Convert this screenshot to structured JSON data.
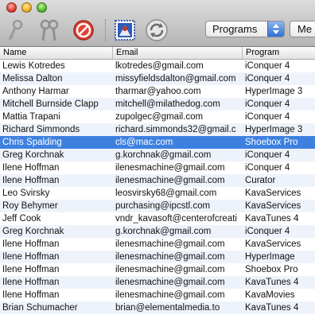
{
  "toolbar": {
    "program_filter": "Programs",
    "menu_button_label": "Me"
  },
  "table": {
    "columns": [
      "Name",
      "Email",
      "Program"
    ],
    "rows": [
      {
        "name": "Lewis Kotredes",
        "email": "lkotredes@gmail.com",
        "program": "iConquer 4"
      },
      {
        "name": "Melissa Dalton",
        "email": "missyfieldsdalton@gmail.com",
        "program": "iConquer 4"
      },
      {
        "name": "Anthony Harmar",
        "email": "tharmar@yahoo.com",
        "program": "HyperImage 3"
      },
      {
        "name": "Mitchell Burnside Clapp",
        "email": "mitchell@milathedog.com",
        "program": "iConquer 4"
      },
      {
        "name": "Mattia Trapani",
        "email": "zupolgec@gmail.com",
        "program": "iConquer 4"
      },
      {
        "name": "Richard Simmonds",
        "email": "richard.simmonds32@gmail.c",
        "program": "HyperImage 3"
      },
      {
        "name": "Chris Spalding",
        "email": "cls@mac.com",
        "program": "Shoebox Pro",
        "selected": true
      },
      {
        "name": "Greg Korchnak",
        "email": "g.korchnak@gmail.com",
        "program": "iConquer 4"
      },
      {
        "name": "Ilene Hoffman",
        "email": "ilenesmachine@gmail.com",
        "program": "iConquer 4"
      },
      {
        "name": "Ilene Hoffman",
        "email": "ilenesmachine@gmail.com",
        "program": "Curator"
      },
      {
        "name": "Leo Svirsky",
        "email": "leosvirsky68@gmail.com",
        "program": "KavaServices"
      },
      {
        "name": "Roy Behymer",
        "email": "purchasing@ipcstl.com",
        "program": "KavaServices"
      },
      {
        "name": "Jeff Cook",
        "email": "vndr_kavasoft@centerofcreati",
        "program": "KavaTunes 4"
      },
      {
        "name": "Greg Korchnak",
        "email": "g.korchnak@gmail.com",
        "program": "iConquer 4"
      },
      {
        "name": "Ilene Hoffman",
        "email": "ilenesmachine@gmail.com",
        "program": "KavaServices"
      },
      {
        "name": "Ilene Hoffman",
        "email": "ilenesmachine@gmail.com",
        "program": "HyperImage"
      },
      {
        "name": "Ilene Hoffman",
        "email": "ilenesmachine@gmail.com",
        "program": "Shoebox Pro"
      },
      {
        "name": "Ilene Hoffman",
        "email": "ilenesmachine@gmail.com",
        "program": "KavaTunes 4"
      },
      {
        "name": "Ilene Hoffman",
        "email": "ilenesmachine@gmail.com",
        "program": "KavaMovies"
      },
      {
        "name": "Brian Schumacher",
        "email": "brian@elementalmedia.to",
        "program": "KavaTunes 4"
      }
    ]
  }
}
